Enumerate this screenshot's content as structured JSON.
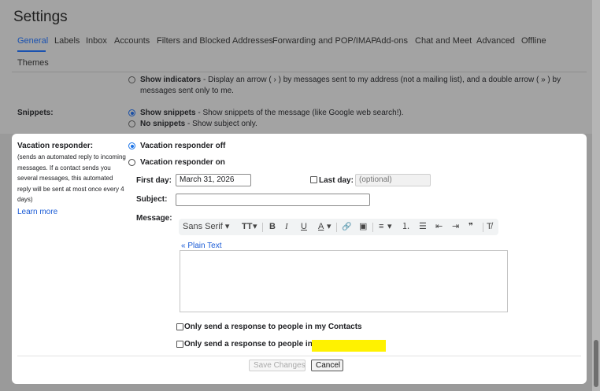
{
  "header": {
    "title": "Settings"
  },
  "tabs": [
    {
      "label": "General",
      "active": true
    },
    {
      "label": "Labels"
    },
    {
      "label": "Inbox"
    },
    {
      "label": "Accounts"
    },
    {
      "label": "Filters and Blocked Addresses"
    },
    {
      "label": "Forwarding and POP/IMAP"
    },
    {
      "label": "Add-ons"
    },
    {
      "label": "Chat and Meet"
    },
    {
      "label": "Advanced"
    },
    {
      "label": "Offline"
    },
    {
      "label": "Themes"
    }
  ],
  "indicators": {
    "option_label": "Show indicators",
    "description_line1": " - Display an arrow ( › ) by messages sent to my address (not a mailing list), and a double arrow ( » ) by",
    "description_line2": "messages sent only to me."
  },
  "snippets": {
    "label": "Snippets:",
    "show_label": "Show snippets",
    "show_desc": " - Show snippets of the message (like Google web search!).",
    "no_label": "No snippets",
    "no_desc": " - Show subject only.",
    "selected": "show"
  },
  "vacation": {
    "label": "Vacation responder:",
    "note": "(sends an automated reply to incoming messages. If a contact sends you several messages, this automated reply will be sent at most once every 4 days)",
    "learn_more": "Learn more",
    "off_label": "Vacation responder off",
    "on_label": "Vacation responder on",
    "selected": "off",
    "first_day_label": "First day:",
    "first_day_value": "March 31, 2026",
    "last_day_label": "Last day:",
    "last_day_placeholder": "(optional)",
    "subject_label": "Subject:",
    "subject_value": "",
    "message_label": "Message:",
    "plain_text_link": "« Plain Text",
    "contacts_only_label": "Only send a response to people in my Contacts",
    "domain_only_label": "Only send a response to people in",
    "highlight_color": "#fff200"
  },
  "toolbar": {
    "font": "Sans Serif",
    "font_dropdown_icon": "▾",
    "size_icon": "TT",
    "bold": "B",
    "italic": "I",
    "underline": "U",
    "text_color": "A",
    "link_icon": "🔗",
    "image_icon": "▣",
    "align_icon": "≡",
    "numbered_list_icon": "⒈",
    "bulleted_list_icon": "☰",
    "indent_less_icon": "⇤",
    "indent_more_icon": "⇥",
    "quote_icon": "❞",
    "remove_format_icon": "T̸"
  },
  "actions": {
    "save_label": "Save Changes",
    "cancel_label": "Cancel"
  }
}
